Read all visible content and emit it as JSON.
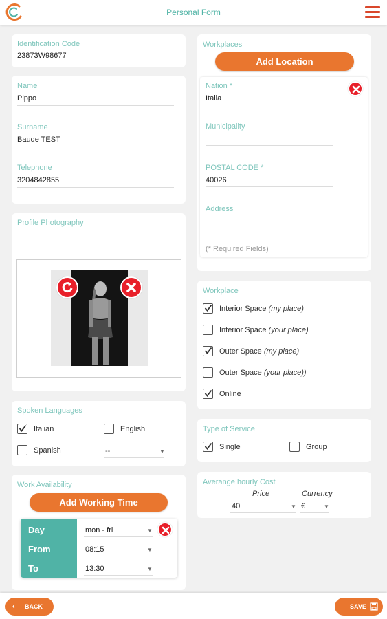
{
  "header": {
    "title": "Personal Form"
  },
  "identification": {
    "label": "Identification Code",
    "value": "23873W98677"
  },
  "personal": {
    "name_label": "Name",
    "name_value": "Pippo",
    "surname_label": "Surname",
    "surname_value": "Baude TEST",
    "telephone_label": "Telephone",
    "telephone_value": "3204842855"
  },
  "photo": {
    "label": "Profile Photography"
  },
  "languages": {
    "label": "Spoken Languages",
    "italian": "Italian",
    "english": "English",
    "spanish": "Spanish",
    "other_select": "--",
    "italian_checked": true,
    "english_checked": false,
    "spanish_checked": false
  },
  "availability": {
    "label": "Work Availability",
    "add_button": "Add Working Time",
    "day_label": "Day",
    "from_label": "From",
    "to_label": "To",
    "day_value": "mon - fri",
    "from_value": "08:15",
    "to_value": "13:30"
  },
  "workplaces": {
    "label": "Workplaces",
    "add_button": "Add Location",
    "nation_label": "Nation *",
    "nation_value": "Italia",
    "municipality_label": "Municipality",
    "municipality_value": "",
    "postal_label": "POSTAL CODE *",
    "postal_value": "40026",
    "address_label": "Address",
    "address_value": "",
    "required_note": "(* Required Fields)"
  },
  "workplace_type": {
    "label": "Workplace",
    "items": [
      {
        "text": "Interior Space",
        "note": "(my place)",
        "checked": true
      },
      {
        "text": "Interior Space",
        "note": "(your place)",
        "checked": false
      },
      {
        "text": "Outer Space",
        "note": "(my place)",
        "checked": true
      },
      {
        "text": "Outer Space",
        "note": "(your place))",
        "checked": false
      },
      {
        "text": "Online",
        "note": "",
        "checked": true
      }
    ]
  },
  "service": {
    "label": "Type of Service",
    "single": "Single",
    "group": "Group",
    "single_checked": true,
    "group_checked": false
  },
  "cost": {
    "label": "Averange hourly Cost",
    "price_label": "Price",
    "currency_label": "Currency",
    "price_value": "40",
    "currency_value": "€"
  },
  "footer": {
    "back_label": "BACK",
    "save_label": "SAVE"
  },
  "colors": {
    "accent": "#e9762f",
    "teal": "#50b3a6",
    "danger": "#e8202a"
  }
}
